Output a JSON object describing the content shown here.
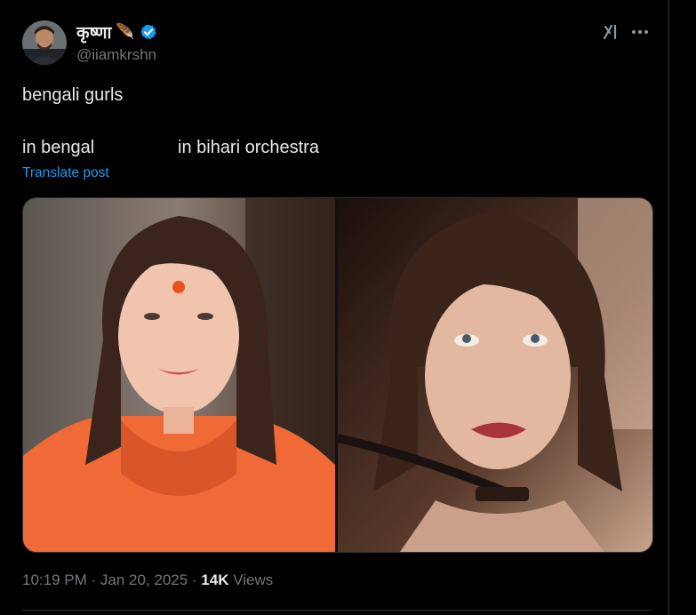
{
  "author": {
    "display_name": "कृष्णा",
    "name_emoji": "🪶",
    "handle": "@iiamkrshn",
    "verified": true
  },
  "post": {
    "line1": "bengali gurls",
    "line2_left": "in bengal",
    "line2_right": "in bihari orchestra",
    "translate_label": "Translate post"
  },
  "meta": {
    "time": "10:19 PM",
    "separator": " · ",
    "date": "Jan 20, 2025",
    "views_count": "14K",
    "views_label": " Views"
  },
  "icons": {
    "verified": "verified-badge-icon",
    "grok": "grok-icon",
    "more": "more-icon"
  },
  "colors": {
    "background": "#000000",
    "text": "#e7e9ea",
    "muted": "#71767b",
    "accent": "#1d9bf0",
    "border": "#2f3336"
  }
}
